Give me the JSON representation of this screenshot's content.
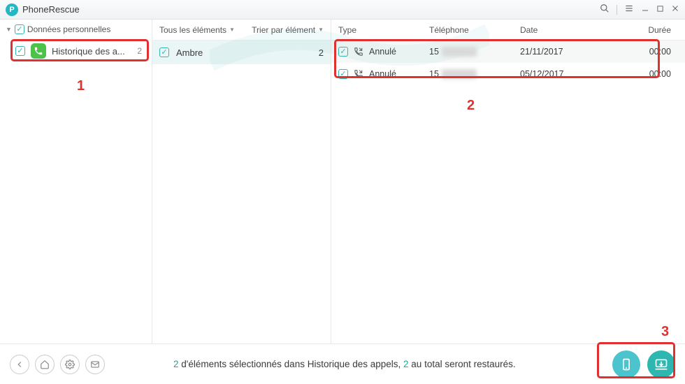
{
  "app": {
    "title": "PhoneRescue"
  },
  "sidebar": {
    "section": "Données personnelles",
    "items": [
      {
        "label": "Historique des a...",
        "count": "2"
      }
    ]
  },
  "middle": {
    "col1": "Tous les éléments",
    "col2": "Trier par élément",
    "rows": [
      {
        "name": "Ambre",
        "count": "2"
      }
    ]
  },
  "right": {
    "headers": {
      "type": "Type",
      "tel": "Téléphone",
      "date": "Date",
      "dur": "Durée"
    },
    "rows": [
      {
        "status": "Annulé",
        "tel_prefix": "15",
        "date": "21/11/2017",
        "dur": "00:00"
      },
      {
        "status": "Annulé",
        "tel_prefix": "15",
        "date": "05/12/2017",
        "dur": "00:00"
      }
    ]
  },
  "status": {
    "count1": "2",
    "text1": " d'éléments sélectionnés dans Historique des appels, ",
    "count2": "2",
    "text2": " au total seront restaurés."
  },
  "annotations": {
    "a1": "1",
    "a2": "2",
    "a3": "3"
  }
}
